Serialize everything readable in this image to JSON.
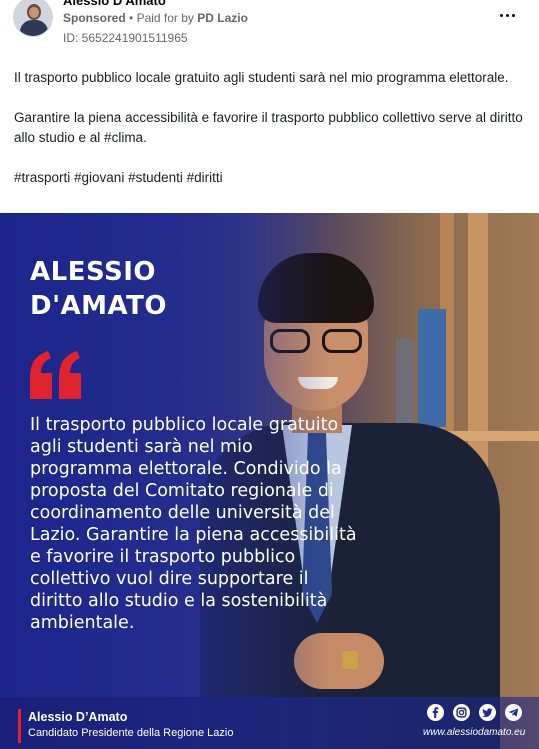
{
  "header": {
    "page_name": "Alessio D'Amato",
    "sponsored": "Sponsored",
    "separator": "•",
    "paid_for_prefix": "Paid for by",
    "payer": "PD Lazio",
    "ad_id": "ID: 5652241901511965",
    "more_icon": "more-horizontal-icon"
  },
  "post": {
    "paragraph_1": "Il trasporto pubblico locale gratuito agli studenti sarà nel mio programma elettorale.",
    "paragraph_2": "Garantire la piena accessibilità e favorire il trasporto pubblico collettivo serve al diritto allo studio e al #clima.",
    "hashtags": "#trasporti #giovani #studenti #diritti"
  },
  "creative": {
    "name_line_1": "ALESSIO",
    "name_line_2": "D'AMATO",
    "quote_icon": "quote-mark-icon",
    "quote_text": "Il trasporto pubblico locale gratuito agli studenti sarà nel mio programma elettorale. Condivido la proposta del Comitato regionale di coordinamento delle università del Lazio. Garantire la piena accessibilità e favorire il trasporto pubblico collettivo vuol dire supportare il diritto allo studio e la sostenibilità ambientale.",
    "footer_name": "Alessio D’Amato",
    "footer_role": "Candidato Presidente della Regione Lazio",
    "website": "www.alessiodamato.eu",
    "social_icons": [
      "facebook-icon",
      "instagram-icon",
      "twitter-icon",
      "telegram-icon"
    ],
    "colors": {
      "background_blue": "#1f2a8a",
      "quote_red": "#e0242d",
      "text": "#ffffff"
    }
  }
}
